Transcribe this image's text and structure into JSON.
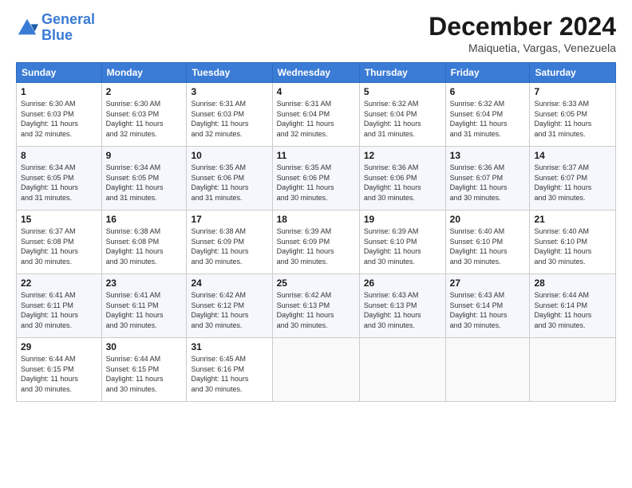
{
  "header": {
    "logo_line1": "General",
    "logo_line2": "Blue",
    "month": "December 2024",
    "location": "Maiquetia, Vargas, Venezuela"
  },
  "days_of_week": [
    "Sunday",
    "Monday",
    "Tuesday",
    "Wednesday",
    "Thursday",
    "Friday",
    "Saturday"
  ],
  "weeks": [
    [
      {
        "day": "1",
        "info": "Sunrise: 6:30 AM\nSunset: 6:03 PM\nDaylight: 11 hours\nand 32 minutes."
      },
      {
        "day": "2",
        "info": "Sunrise: 6:30 AM\nSunset: 6:03 PM\nDaylight: 11 hours\nand 32 minutes."
      },
      {
        "day": "3",
        "info": "Sunrise: 6:31 AM\nSunset: 6:03 PM\nDaylight: 11 hours\nand 32 minutes."
      },
      {
        "day": "4",
        "info": "Sunrise: 6:31 AM\nSunset: 6:04 PM\nDaylight: 11 hours\nand 32 minutes."
      },
      {
        "day": "5",
        "info": "Sunrise: 6:32 AM\nSunset: 6:04 PM\nDaylight: 11 hours\nand 31 minutes."
      },
      {
        "day": "6",
        "info": "Sunrise: 6:32 AM\nSunset: 6:04 PM\nDaylight: 11 hours\nand 31 minutes."
      },
      {
        "day": "7",
        "info": "Sunrise: 6:33 AM\nSunset: 6:05 PM\nDaylight: 11 hours\nand 31 minutes."
      }
    ],
    [
      {
        "day": "8",
        "info": "Sunrise: 6:34 AM\nSunset: 6:05 PM\nDaylight: 11 hours\nand 31 minutes."
      },
      {
        "day": "9",
        "info": "Sunrise: 6:34 AM\nSunset: 6:05 PM\nDaylight: 11 hours\nand 31 minutes."
      },
      {
        "day": "10",
        "info": "Sunrise: 6:35 AM\nSunset: 6:06 PM\nDaylight: 11 hours\nand 31 minutes."
      },
      {
        "day": "11",
        "info": "Sunrise: 6:35 AM\nSunset: 6:06 PM\nDaylight: 11 hours\nand 30 minutes."
      },
      {
        "day": "12",
        "info": "Sunrise: 6:36 AM\nSunset: 6:06 PM\nDaylight: 11 hours\nand 30 minutes."
      },
      {
        "day": "13",
        "info": "Sunrise: 6:36 AM\nSunset: 6:07 PM\nDaylight: 11 hours\nand 30 minutes."
      },
      {
        "day": "14",
        "info": "Sunrise: 6:37 AM\nSunset: 6:07 PM\nDaylight: 11 hours\nand 30 minutes."
      }
    ],
    [
      {
        "day": "15",
        "info": "Sunrise: 6:37 AM\nSunset: 6:08 PM\nDaylight: 11 hours\nand 30 minutes."
      },
      {
        "day": "16",
        "info": "Sunrise: 6:38 AM\nSunset: 6:08 PM\nDaylight: 11 hours\nand 30 minutes."
      },
      {
        "day": "17",
        "info": "Sunrise: 6:38 AM\nSunset: 6:09 PM\nDaylight: 11 hours\nand 30 minutes."
      },
      {
        "day": "18",
        "info": "Sunrise: 6:39 AM\nSunset: 6:09 PM\nDaylight: 11 hours\nand 30 minutes."
      },
      {
        "day": "19",
        "info": "Sunrise: 6:39 AM\nSunset: 6:10 PM\nDaylight: 11 hours\nand 30 minutes."
      },
      {
        "day": "20",
        "info": "Sunrise: 6:40 AM\nSunset: 6:10 PM\nDaylight: 11 hours\nand 30 minutes."
      },
      {
        "day": "21",
        "info": "Sunrise: 6:40 AM\nSunset: 6:10 PM\nDaylight: 11 hours\nand 30 minutes."
      }
    ],
    [
      {
        "day": "22",
        "info": "Sunrise: 6:41 AM\nSunset: 6:11 PM\nDaylight: 11 hours\nand 30 minutes."
      },
      {
        "day": "23",
        "info": "Sunrise: 6:41 AM\nSunset: 6:11 PM\nDaylight: 11 hours\nand 30 minutes."
      },
      {
        "day": "24",
        "info": "Sunrise: 6:42 AM\nSunset: 6:12 PM\nDaylight: 11 hours\nand 30 minutes."
      },
      {
        "day": "25",
        "info": "Sunrise: 6:42 AM\nSunset: 6:13 PM\nDaylight: 11 hours\nand 30 minutes."
      },
      {
        "day": "26",
        "info": "Sunrise: 6:43 AM\nSunset: 6:13 PM\nDaylight: 11 hours\nand 30 minutes."
      },
      {
        "day": "27",
        "info": "Sunrise: 6:43 AM\nSunset: 6:14 PM\nDaylight: 11 hours\nand 30 minutes."
      },
      {
        "day": "28",
        "info": "Sunrise: 6:44 AM\nSunset: 6:14 PM\nDaylight: 11 hours\nand 30 minutes."
      }
    ],
    [
      {
        "day": "29",
        "info": "Sunrise: 6:44 AM\nSunset: 6:15 PM\nDaylight: 11 hours\nand 30 minutes."
      },
      {
        "day": "30",
        "info": "Sunrise: 6:44 AM\nSunset: 6:15 PM\nDaylight: 11 hours\nand 30 minutes."
      },
      {
        "day": "31",
        "info": "Sunrise: 6:45 AM\nSunset: 6:16 PM\nDaylight: 11 hours\nand 30 minutes."
      },
      {
        "day": "",
        "info": ""
      },
      {
        "day": "",
        "info": ""
      },
      {
        "day": "",
        "info": ""
      },
      {
        "day": "",
        "info": ""
      }
    ]
  ]
}
